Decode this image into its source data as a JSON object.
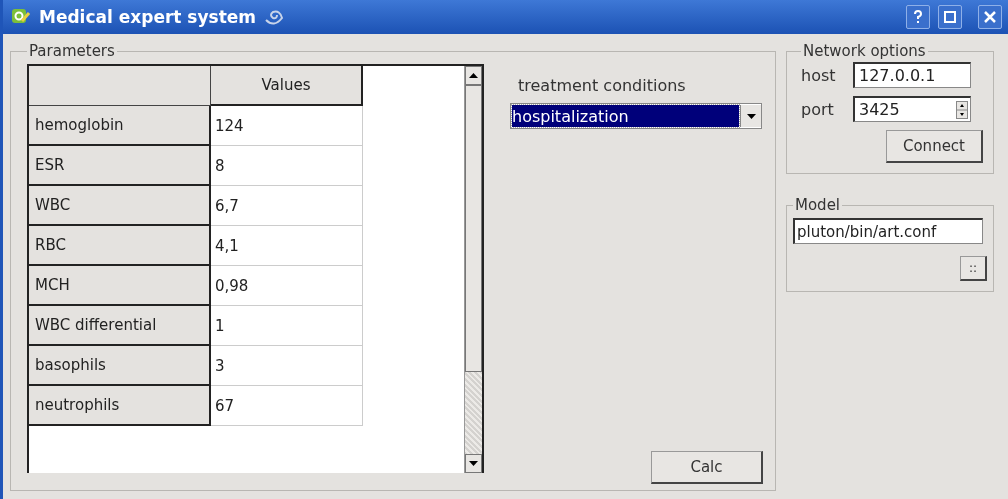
{
  "window": {
    "title": "Medical expert system"
  },
  "parameters": {
    "title": "Parameters",
    "column": "Values",
    "rows": [
      {
        "name": "hemoglobin",
        "value": "124"
      },
      {
        "name": "ESR",
        "value": "8"
      },
      {
        "name": "WBC",
        "value": "6,7"
      },
      {
        "name": "RBC",
        "value": "4,1"
      },
      {
        "name": "MCH",
        "value": "0,98"
      },
      {
        "name": "WBC differential",
        "value": "1"
      },
      {
        "name": "basophils",
        "value": "3"
      },
      {
        "name": "neutrophils",
        "value": "67"
      }
    ]
  },
  "treatment": {
    "label": "treatment conditions",
    "value": "hospitalization"
  },
  "calc_button": "Calc",
  "network": {
    "title": "Network options",
    "host_label": "host",
    "host": "127.0.0.1",
    "port_label": "port",
    "port": "3425",
    "connect_button": "Connect"
  },
  "model": {
    "title": "Model",
    "path": "pluton/bin/art.conf",
    "browse_button": "::"
  }
}
